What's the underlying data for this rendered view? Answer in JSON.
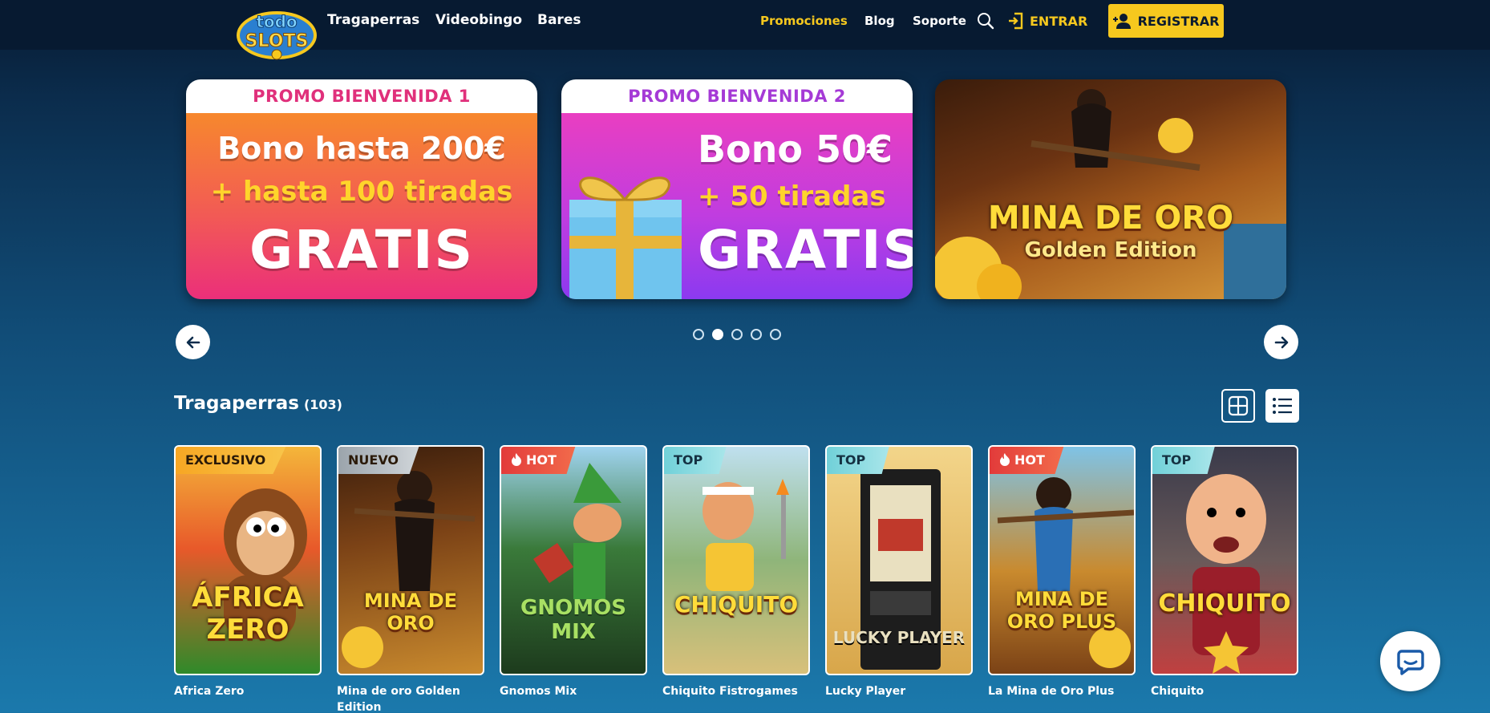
{
  "header": {
    "logo_alt": "Todoslots",
    "nav": [
      "Tragaperras",
      "Videobingo",
      "Bares"
    ],
    "promotions": "Promociones",
    "blog": "Blog",
    "support": "Soporte",
    "login": "ENTRAR",
    "register": "REGISTRAR"
  },
  "banners": [
    {
      "head": "PROMO BIENVENIDA 1",
      "line1": "Bono hasta 200€",
      "line2": "+ hasta 100 tiradas",
      "line3": "GRATIS"
    },
    {
      "head": "PROMO BIENVENIDA 2",
      "line1": "Bono 50€",
      "line2": "+ 50 tiradas",
      "line3": "GRATIS"
    },
    {
      "title": "MINA DE ORO",
      "subtitle": "Golden Edition"
    }
  ],
  "carousel": {
    "dots": 5,
    "active_index": 1
  },
  "section": {
    "title": "Tragaperras",
    "count": "(103)"
  },
  "games": [
    {
      "tag": "EXCLUSIVO",
      "label": "Africa Zero",
      "art": "ÁFRICA ZERO"
    },
    {
      "tag": "NUEVO",
      "label": "Mina de oro Golden Edition",
      "art": "MINA DE ORO"
    },
    {
      "tag": "HOT",
      "label": "Gnomos Mix",
      "art": "GNOMOS MIX"
    },
    {
      "tag": "TOP",
      "label": "Chiquito Fistrogames",
      "art": "CHIQUITO"
    },
    {
      "tag": "TOP",
      "label": "Lucky Player",
      "art": "LUCKY PLAYER"
    },
    {
      "tag": "HOT",
      "label": "La Mina de Oro Plus",
      "art": "MINA DE ORO PLUS"
    },
    {
      "tag": "TOP",
      "label": "Chiquito",
      "art": "CHIQUITO"
    }
  ],
  "colors": {
    "accent": "#f6c81e",
    "bg_top": "#071a31",
    "bg_bottom": "#1b79ac"
  }
}
